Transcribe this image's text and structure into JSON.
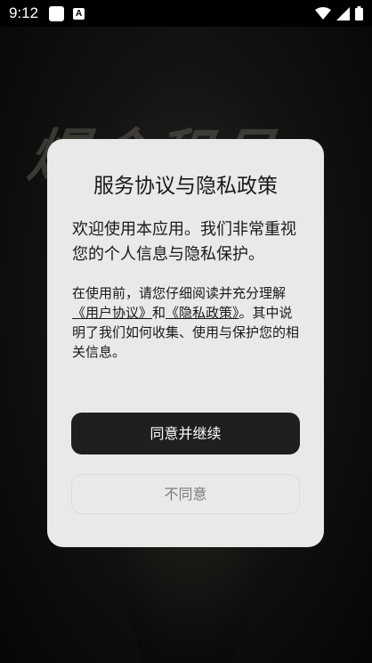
{
  "status_bar": {
    "time": "9:12",
    "notification_letter": "A"
  },
  "background": {
    "game_title": "爆金租号"
  },
  "dialog": {
    "title": "服务协议与隐私政策",
    "intro": "欢迎使用本应用。我们非常重视您的个人信息与隐私保护。",
    "body_prefix": "在使用前，请您仔细阅读并充分理解",
    "user_agreement_link": "《用户协议》",
    "body_and": "和",
    "privacy_policy_link": "《隐私政策》",
    "body_suffix": "。其中说明了我们如何收集、使用与保护您的相关信息。",
    "agree_label": "同意并继续",
    "disagree_label": "不同意"
  }
}
